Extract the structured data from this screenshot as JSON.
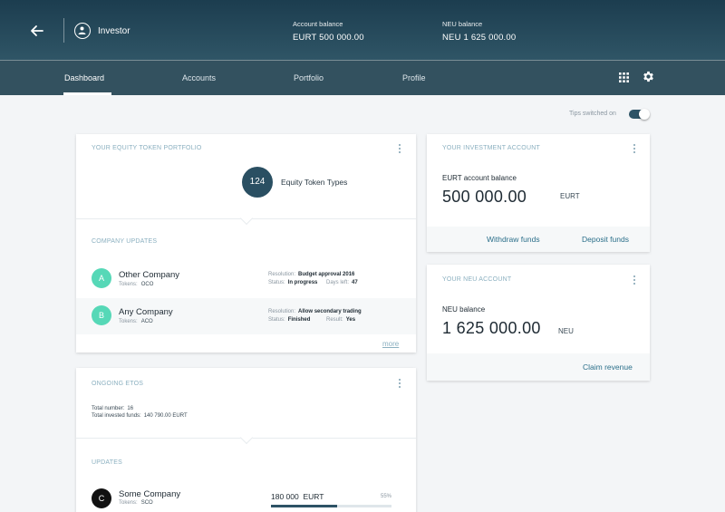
{
  "header": {
    "user_name": "Investor",
    "account_balance_label": "Account balance",
    "account_balance_value": "EURT 500 000.00",
    "neu_balance_label": "NEU balance",
    "neu_balance_value": "NEU 1 625 000.00"
  },
  "nav": {
    "tabs": [
      {
        "label": "Dashboard",
        "active": true
      },
      {
        "label": "Accounts",
        "active": false
      },
      {
        "label": "Portfolio",
        "active": false
      },
      {
        "label": "Profile",
        "active": false
      }
    ]
  },
  "tips": {
    "label": "Tips switched on",
    "on": true
  },
  "portfolio": {
    "title": "YOUR EQUITY TOKEN PORTFOLIO",
    "count": "124",
    "count_label": "Equity Token Types",
    "updates_title": "COMPANY UPDATES",
    "companies": [
      {
        "initial": "A",
        "name": "Other Company",
        "tokens_label": "Tokens:",
        "tokens": "OCO",
        "resolution_label": "Resolution:",
        "resolution": "Budget approval 2016",
        "status_label": "Status:",
        "status": "In progress",
        "extra_label": "Days left:",
        "extra": "47"
      },
      {
        "initial": "B",
        "name": "Any Company",
        "tokens_label": "Tokens:",
        "tokens": "ACO",
        "resolution_label": "Resolution:",
        "resolution": "Allow secondary trading",
        "status_label": "Status:",
        "status": "Finished",
        "extra_label": "Result:",
        "extra": "Yes"
      }
    ],
    "more_label": "more"
  },
  "etos": {
    "title": "ONGOING ETOS",
    "total_number_label": "Total number:",
    "total_number": "16",
    "total_funds_label": "Total invested funds:",
    "total_funds": "140 790.00 EURT",
    "updates_title": "UPDATES",
    "company": {
      "initial": "C",
      "name": "Some Company",
      "tokens_label": "Tokens:",
      "tokens": "SCO",
      "amount": "180 000",
      "currency": "EURT",
      "percent": "55%",
      "progress": 0.55
    }
  },
  "investment_account": {
    "title": "YOUR INVESTMENT ACCOUNT",
    "balance_label": "EURT account balance",
    "balance_value": "500 000.00",
    "currency": "EURT",
    "withdraw_label": "Withdraw funds",
    "deposit_label": "Deposit funds"
  },
  "neu_account": {
    "title": "YOUR NEU ACCOUNT",
    "balance_label": "NEU balance",
    "balance_value": "1 625 000.00",
    "currency": "NEU",
    "claim_label": "Claim revenue"
  },
  "colors": {
    "header": "#1c3d4f",
    "nav": "#33515f",
    "accent": "#2b6f8a",
    "avatar_green": "#56d8b7"
  }
}
